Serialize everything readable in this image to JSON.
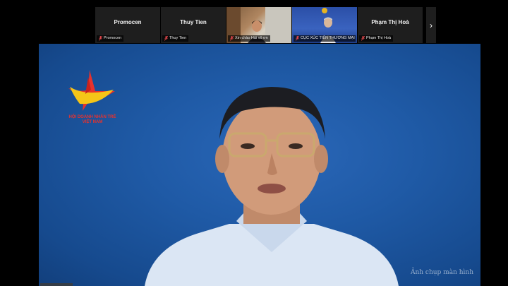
{
  "gallery": {
    "tiles": [
      {
        "display_name": "Promocen",
        "footer_label": "Promocen"
      },
      {
        "display_name": "Thuy Tien",
        "footer_label": "Thuy Tien"
      },
      {
        "footer_label": "Xin chào Hải vô ơn"
      },
      {
        "footer_label": "CỤC XÚC TIẾN THƯƠNG MẠI -..."
      },
      {
        "display_name": "Phạm Thị Hoà",
        "footer_label": "Phạm Thị Hoà"
      }
    ],
    "next_page_glyph": "›"
  },
  "main": {
    "logo_text_line1": "HỘI DOANH NHÂN TRẺ",
    "logo_text_line2": "VIỆT NAM"
  },
  "watermark": "Ảnh chụp màn hình",
  "colors": {
    "backdrop_blue": "#1f5aa6",
    "logo_red": "#e8322d",
    "logo_yellow": "#f5c518",
    "muted_mic_red": "#e5484d"
  }
}
